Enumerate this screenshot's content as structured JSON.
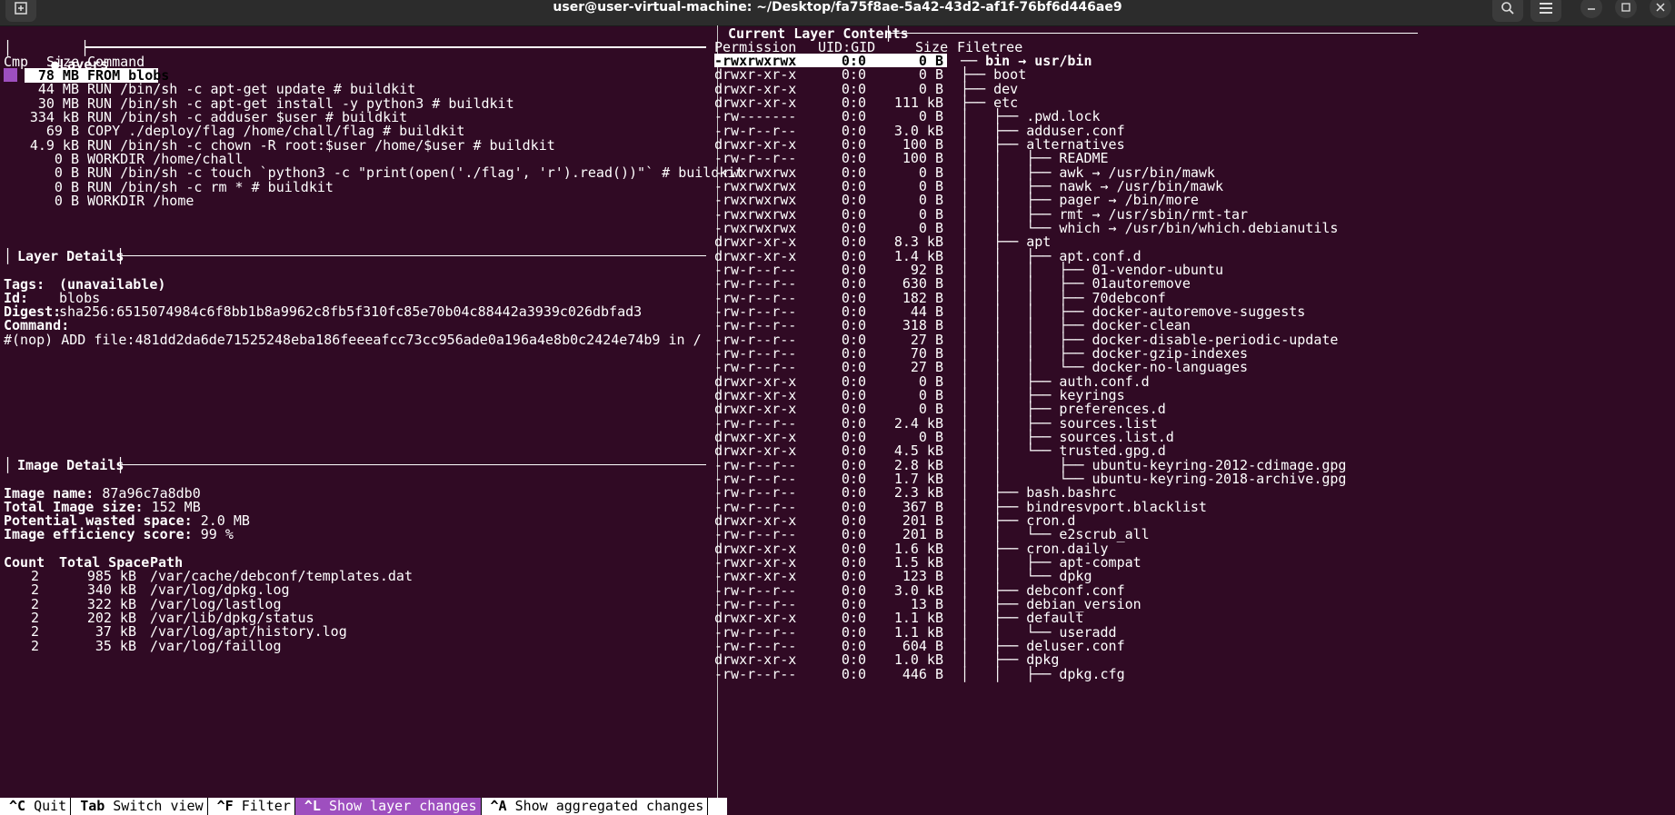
{
  "window": {
    "title": "user@user-virtual-machine: ~/Desktop/fa75f8ae-5a42-43d2-af1f-76bf6d446ae9"
  },
  "panels": {
    "layers": {
      "title": "Layers",
      "col_cmp": "Cmp",
      "col_size": "Size",
      "col_command": "Command",
      "rows": [
        {
          "size": "78 MB",
          "command": "FROM blobs"
        },
        {
          "size": "44 MB",
          "command": "RUN /bin/sh -c apt-get update # buildkit"
        },
        {
          "size": "30 MB",
          "command": "RUN /bin/sh -c apt-get install -y python3 # buildkit"
        },
        {
          "size": "334 kB",
          "command": "RUN /bin/sh -c adduser $user # buildkit"
        },
        {
          "size": "69 B",
          "command": "COPY ./deploy/flag /home/chall/flag # buildkit"
        },
        {
          "size": "4.9 kB",
          "command": "RUN /bin/sh -c chown -R root:$user /home/$user # buildkit"
        },
        {
          "size": "0 B",
          "command": "WORKDIR /home/chall"
        },
        {
          "size": "0 B",
          "command": "RUN /bin/sh -c touch `python3 -c \"print(open('./flag', 'r').read())\"` # buildkit"
        },
        {
          "size": "0 B",
          "command": "RUN /bin/sh -c rm * # buildkit"
        },
        {
          "size": "0 B",
          "command": "WORKDIR /home"
        }
      ]
    },
    "layer_details": {
      "title": "Layer Details",
      "tags_label": "Tags:",
      "tags_value": "(unavailable)",
      "id_label": "Id:",
      "id_value": "blobs",
      "digest_label": "Digest:",
      "digest_value": "sha256:6515074984c6f8bb1b8a9962c8fb5f310fc85e70b04c88442a3939c026dbfad3",
      "command_label": "Command:",
      "command_value": "#(nop) ADD file:481dd2da6de71525248eba186feeeafcc73cc956ade0a196a4e8b0c2424e74b9 in /"
    },
    "image_details": {
      "title": "Image Details",
      "name_label": "Image name:",
      "name_value": "87a96c7a8db0",
      "size_label": "Total Image size:",
      "size_value": "152 MB",
      "wasted_label": "Potential wasted space:",
      "wasted_value": "2.0 MB",
      "eff_label": "Image efficiency score:",
      "eff_value": "99 %",
      "col_count": "Count",
      "col_space": "Total Space",
      "col_path": "Path",
      "rows": [
        {
          "count": "2",
          "space": "985 kB",
          "path": "/var/cache/debconf/templates.dat"
        },
        {
          "count": "2",
          "space": "340 kB",
          "path": "/var/log/dpkg.log"
        },
        {
          "count": "2",
          "space": "322 kB",
          "path": "/var/log/lastlog"
        },
        {
          "count": "2",
          "space": "202 kB",
          "path": "/var/lib/dpkg/status"
        },
        {
          "count": "2",
          "space": "37 kB",
          "path": "/var/log/apt/history.log"
        },
        {
          "count": "2",
          "space": "35 kB",
          "path": "/var/log/faillog"
        }
      ]
    },
    "contents": {
      "title": "Current Layer Contents",
      "col_perm": "Permission",
      "col_uid": "UID:GID",
      "col_size": "Size",
      "col_tree": "Filetree",
      "rows": [
        {
          "perm": "-rwxrwxrwx",
          "uid": "0:0",
          "size": "0 B",
          "tree": "── bin → usr/bin",
          "sel": true
        },
        {
          "perm": "drwxr-xr-x",
          "uid": "0:0",
          "size": "0 B",
          "tree": "├── boot"
        },
        {
          "perm": "drwxr-xr-x",
          "uid": "0:0",
          "size": "0 B",
          "tree": "├── dev"
        },
        {
          "perm": "drwxr-xr-x",
          "uid": "0:0",
          "size": "111 kB",
          "tree": "├── etc"
        },
        {
          "perm": "-rw-------",
          "uid": "0:0",
          "size": "0 B",
          "tree": "│   ├── .pwd.lock"
        },
        {
          "perm": "-rw-r--r--",
          "uid": "0:0",
          "size": "3.0 kB",
          "tree": "│   ├── adduser.conf"
        },
        {
          "perm": "drwxr-xr-x",
          "uid": "0:0",
          "size": "100 B",
          "tree": "│   ├── alternatives"
        },
        {
          "perm": "-rw-r--r--",
          "uid": "0:0",
          "size": "100 B",
          "tree": "│   │   ├── README"
        },
        {
          "perm": "-rwxrwxrwx",
          "uid": "0:0",
          "size": "0 B",
          "tree": "│   │   ├── awk → /usr/bin/mawk"
        },
        {
          "perm": "-rwxrwxrwx",
          "uid": "0:0",
          "size": "0 B",
          "tree": "│   │   ├── nawk → /usr/bin/mawk"
        },
        {
          "perm": "-rwxrwxrwx",
          "uid": "0:0",
          "size": "0 B",
          "tree": "│   │   ├── pager → /bin/more"
        },
        {
          "perm": "-rwxrwxrwx",
          "uid": "0:0",
          "size": "0 B",
          "tree": "│   │   ├── rmt → /usr/sbin/rmt-tar"
        },
        {
          "perm": "-rwxrwxrwx",
          "uid": "0:0",
          "size": "0 B",
          "tree": "│   │   └── which → /usr/bin/which.debianutils"
        },
        {
          "perm": "drwxr-xr-x",
          "uid": "0:0",
          "size": "8.3 kB",
          "tree": "│   ├── apt"
        },
        {
          "perm": "drwxr-xr-x",
          "uid": "0:0",
          "size": "1.4 kB",
          "tree": "│   │   ├── apt.conf.d"
        },
        {
          "perm": "-rw-r--r--",
          "uid": "0:0",
          "size": "92 B",
          "tree": "│   │   │   ├── 01-vendor-ubuntu"
        },
        {
          "perm": "-rw-r--r--",
          "uid": "0:0",
          "size": "630 B",
          "tree": "│   │   │   ├── 01autoremove"
        },
        {
          "perm": "-rw-r--r--",
          "uid": "0:0",
          "size": "182 B",
          "tree": "│   │   │   ├── 70debconf"
        },
        {
          "perm": "-rw-r--r--",
          "uid": "0:0",
          "size": "44 B",
          "tree": "│   │   │   ├── docker-autoremove-suggests"
        },
        {
          "perm": "-rw-r--r--",
          "uid": "0:0",
          "size": "318 B",
          "tree": "│   │   │   ├── docker-clean"
        },
        {
          "perm": "-rw-r--r--",
          "uid": "0:0",
          "size": "27 B",
          "tree": "│   │   │   ├── docker-disable-periodic-update"
        },
        {
          "perm": "-rw-r--r--",
          "uid": "0:0",
          "size": "70 B",
          "tree": "│   │   │   ├── docker-gzip-indexes"
        },
        {
          "perm": "-rw-r--r--",
          "uid": "0:0",
          "size": "27 B",
          "tree": "│   │   │   └── docker-no-languages"
        },
        {
          "perm": "drwxr-xr-x",
          "uid": "0:0",
          "size": "0 B",
          "tree": "│   │   ├── auth.conf.d"
        },
        {
          "perm": "drwxr-xr-x",
          "uid": "0:0",
          "size": "0 B",
          "tree": "│   │   ├── keyrings"
        },
        {
          "perm": "drwxr-xr-x",
          "uid": "0:0",
          "size": "0 B",
          "tree": "│   │   ├── preferences.d"
        },
        {
          "perm": "-rw-r--r--",
          "uid": "0:0",
          "size": "2.4 kB",
          "tree": "│   │   ├── sources.list"
        },
        {
          "perm": "drwxr-xr-x",
          "uid": "0:0",
          "size": "0 B",
          "tree": "│   │   ├── sources.list.d"
        },
        {
          "perm": "drwxr-xr-x",
          "uid": "0:0",
          "size": "4.5 kB",
          "tree": "│   │   └── trusted.gpg.d"
        },
        {
          "perm": "-rw-r--r--",
          "uid": "0:0",
          "size": "2.8 kB",
          "tree": "│   │       ├── ubuntu-keyring-2012-cdimage.gpg"
        },
        {
          "perm": "-rw-r--r--",
          "uid": "0:0",
          "size": "1.7 kB",
          "tree": "│   │       └── ubuntu-keyring-2018-archive.gpg"
        },
        {
          "perm": "-rw-r--r--",
          "uid": "0:0",
          "size": "2.3 kB",
          "tree": "│   ├── bash.bashrc"
        },
        {
          "perm": "-rw-r--r--",
          "uid": "0:0",
          "size": "367 B",
          "tree": "│   ├── bindresvport.blacklist"
        },
        {
          "perm": "drwxr-xr-x",
          "uid": "0:0",
          "size": "201 B",
          "tree": "│   ├── cron.d"
        },
        {
          "perm": "-rw-r--r--",
          "uid": "0:0",
          "size": "201 B",
          "tree": "│   │   └── e2scrub_all"
        },
        {
          "perm": "drwxr-xr-x",
          "uid": "0:0",
          "size": "1.6 kB",
          "tree": "│   ├── cron.daily"
        },
        {
          "perm": "-rwxr-xr-x",
          "uid": "0:0",
          "size": "1.5 kB",
          "tree": "│   │   ├── apt-compat"
        },
        {
          "perm": "-rwxr-xr-x",
          "uid": "0:0",
          "size": "123 B",
          "tree": "│   │   └── dpkg"
        },
        {
          "perm": "-rw-r--r--",
          "uid": "0:0",
          "size": "3.0 kB",
          "tree": "│   ├── debconf.conf"
        },
        {
          "perm": "-rw-r--r--",
          "uid": "0:0",
          "size": "13 B",
          "tree": "│   ├── debian_version"
        },
        {
          "perm": "drwxr-xr-x",
          "uid": "0:0",
          "size": "1.1 kB",
          "tree": "│   ├── default"
        },
        {
          "perm": "-rw-r--r--",
          "uid": "0:0",
          "size": "1.1 kB",
          "tree": "│   │   └── useradd"
        },
        {
          "perm": "-rw-r--r--",
          "uid": "0:0",
          "size": "604 B",
          "tree": "│   ├── deluser.conf"
        },
        {
          "perm": "drwxr-xr-x",
          "uid": "0:0",
          "size": "1.0 kB",
          "tree": "│   ├── dpkg"
        },
        {
          "perm": "-rw-r--r--",
          "uid": "0:0",
          "size": "446 B",
          "tree": "│   │   ├── dpkg.cfg"
        }
      ]
    }
  },
  "footer": [
    {
      "key": "^C",
      "label": "Quit",
      "active": false
    },
    {
      "key": "Tab",
      "label": "Switch view",
      "active": false
    },
    {
      "key": "^F",
      "label": "Filter",
      "active": false
    },
    {
      "key": "^L",
      "label": "Show layer changes",
      "active": true
    },
    {
      "key": "^A",
      "label": "Show aggregated changes",
      "active": false
    }
  ],
  "colors": {
    "background": "#300a24",
    "accent": "#9e4fbf",
    "text": "#ffffff"
  },
  "icons": [
    "new-tab-icon",
    "search-icon",
    "hamburger-menu-icon",
    "minimize-icon",
    "maximize-icon",
    "close-icon",
    "layer-bullet-icon"
  ]
}
